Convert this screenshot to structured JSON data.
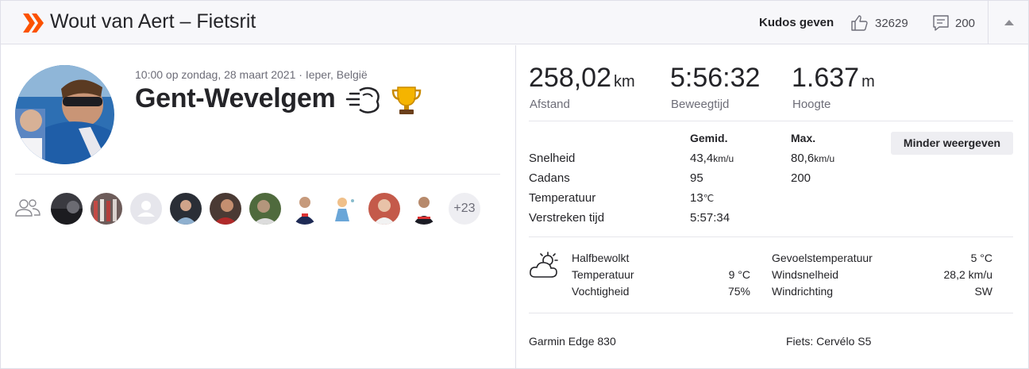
{
  "header": {
    "title": "Wout van Aert – Fietsrit",
    "kudos_button": "Kudos geven",
    "kudos_count": "32629",
    "comment_count": "200"
  },
  "activity": {
    "meta": "10:00 op zondag, 28 maart 2021 · Ieper, België",
    "name": "Gent-Wevelgem"
  },
  "group": {
    "more_label": "+23"
  },
  "stats": {
    "distance": {
      "value": "258,02",
      "unit": "km",
      "label": "Afstand"
    },
    "moving_time": {
      "value": "5:56:32",
      "label": "Beweegtijd"
    },
    "elevation": {
      "value": "1.637",
      "unit": "m",
      "label": "Hoogte"
    }
  },
  "table": {
    "col_avg": "Gemid.",
    "col_max": "Max.",
    "less_button": "Minder weergeven",
    "rows": [
      {
        "label": "Snelheid",
        "avg": "43,4",
        "avg_unit": "km/u",
        "max": "80,6",
        "max_unit": "km/u"
      },
      {
        "label": "Cadans",
        "avg": "95",
        "avg_unit": "",
        "max": "200",
        "max_unit": ""
      },
      {
        "label": "Temperatuur",
        "avg": "13",
        "avg_unit": "℃",
        "max": "",
        "max_unit": ""
      },
      {
        "label": "Verstreken tijd",
        "avg": "5:57:34",
        "avg_unit": "",
        "max": "",
        "max_unit": ""
      }
    ]
  },
  "weather": {
    "condition": "Halfbewolkt",
    "temperature_label": "Temperatuur",
    "temperature_value": "9 °C",
    "humidity_label": "Vochtigheid",
    "humidity_value": "75%",
    "feels_like_label": "Gevoelstemperatuur",
    "feels_like_value": "5 °C",
    "wind_speed_label": "Windsnelheid",
    "wind_speed_value": "28,2 km/u",
    "wind_dir_label": "Windrichting",
    "wind_dir_value": "SW"
  },
  "gear": {
    "device": "Garmin Edge 830",
    "bike": "Fiets: Cervélo S5"
  },
  "colors": {
    "brand": "#fc5200",
    "text": "#242428",
    "muted": "#6d6d78"
  }
}
